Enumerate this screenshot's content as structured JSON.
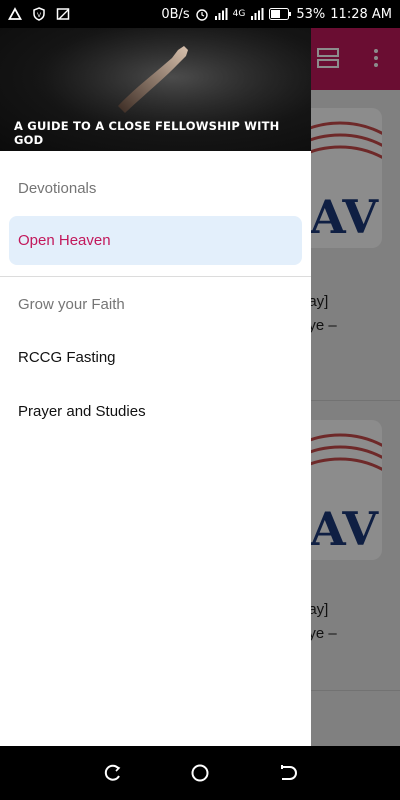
{
  "status_bar": {
    "speed": "0B/s",
    "network": "4G",
    "battery": "53%",
    "time": "11:28 AM"
  },
  "drawer": {
    "header_caption": "A GUIDE TO A CLOSE FELLOWSHIP WITH GOD",
    "sections": [
      {
        "label": "Devotionals"
      },
      {
        "label": "Grow your Faith"
      }
    ],
    "items": [
      {
        "label": "Open Heaven",
        "active": true
      },
      {
        "label": "RCCG Fasting",
        "active": false
      },
      {
        "label": "Prayer and Studies",
        "active": false
      }
    ]
  },
  "background": {
    "cards": [
      {
        "line1": "day]",
        "line2": "oye –"
      },
      {
        "line1": "day]",
        "line2": "oye –"
      }
    ]
  },
  "colors": {
    "accent": "#c2185b",
    "active_bg": "#e3effb"
  },
  "icons": {
    "status_left": [
      "drive-icon",
      "vpn-shield-icon",
      "cast-icon"
    ],
    "toolbar": [
      "view-toggle-icon",
      "more-vert-icon"
    ],
    "nav": [
      "recent-apps-icon",
      "home-icon",
      "back-icon"
    ]
  }
}
